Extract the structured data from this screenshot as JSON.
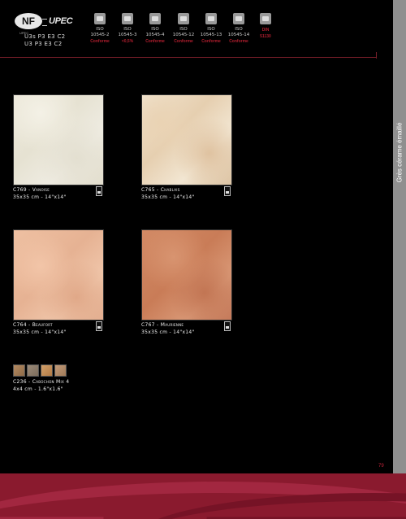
{
  "header": {
    "nf_logo": "NF",
    "nf_sub": "UPEC",
    "upec_logo": "UPEC",
    "cert_line_1": "U3s P3 E3 C2",
    "cert_line_2": "U3 P3 E3 C2",
    "iso_badges": [
      {
        "icon": "tile-icon",
        "line1": "ISO",
        "line2": "10545-2",
        "result": "Conforme"
      },
      {
        "icon": "water-drop-icon",
        "line1": "ISO",
        "line2": "10545-3",
        "result": "<0,5%"
      },
      {
        "icon": "weight-icon",
        "line1": "ISO",
        "line2": "10545-4",
        "result": "Conforme"
      },
      {
        "icon": "frost-icon",
        "line1": "ISO",
        "line2": "10545-12",
        "result": "Conforme"
      },
      {
        "icon": "chemical-icon",
        "line1": "ISO",
        "line2": "10545-13",
        "result": "Conforme"
      },
      {
        "icon": "stain-icon",
        "line1": "ISO",
        "line2": "10545-14",
        "result": "Conforme"
      },
      {
        "icon": "din-icon",
        "line1": "DIN",
        "line2": "",
        "result": "51130"
      }
    ]
  },
  "sidebar": {
    "title": "Grès cérame émaillé"
  },
  "products": [
    {
      "name": "C769 - Vanoise",
      "dims": "35x35 cm - 14\"x14\"",
      "pei": "5"
    },
    {
      "name": "C765 - Chablais",
      "dims": "35x35 cm - 14\"x14\"",
      "pei": "5"
    },
    {
      "name": "C764 - Beaufort",
      "dims": "35x35 cm - 14\"x14\"",
      "pei": "5"
    },
    {
      "name": "C767 - Maurienne",
      "dims": "35x35 cm - 14\"x14\"",
      "pei": "4"
    }
  ],
  "mix": {
    "name": "C236 - Cabochon Mix 4",
    "dims": "4x4 cm - 1.6\"x1.6\""
  },
  "page_number": "79",
  "colors": {
    "accent": "#8a1a2e",
    "sidebar": "#8f8f8f",
    "result_text": "#b01e2e"
  }
}
